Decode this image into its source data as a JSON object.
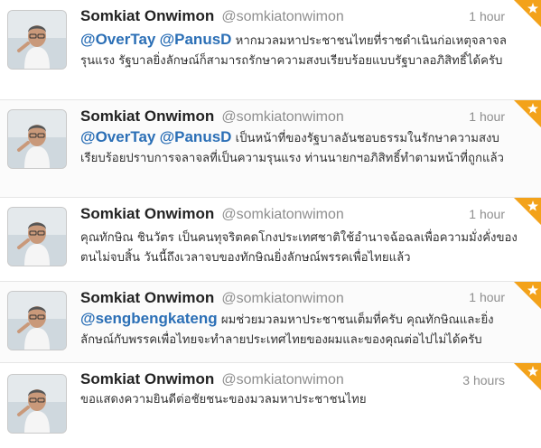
{
  "colors": {
    "star": "#f3a21a",
    "mention": "#2b6fb6"
  },
  "tweets": [
    {
      "name": "Somkiat Onwimon",
      "handle": "@somkiatonwimon",
      "time": "1 hour",
      "mentions": [
        "@OverTay",
        "@PanusD"
      ],
      "text": "หากมวลมหาประชาชนไทยที่ราชดำเนินก่อเหตุจลาจลรุนแรง รัฐบาลยิ่งลักษณ์ก็สามารถรักษาความสงบเรียบร้อยแบบรัฐบาลอภิสิทธิ์ได้ครับ"
    },
    {
      "name": "Somkiat Onwimon",
      "handle": "@somkiatonwimon",
      "time": "1 hour",
      "mentions": [
        "@OverTay",
        "@PanusD"
      ],
      "text": "เป็นหน้าที่ของรัฐบาลอันชอบธรรมในรักษาความสงบเรียบร้อยปราบการจลาจลที่เป็นความรุนแรง ท่านนายกฯอภิสิทธิ์ทำตามหน้าที่ถูกแล้ว"
    },
    {
      "name": "Somkiat Onwimon",
      "handle": "@somkiatonwimon",
      "time": "1 hour",
      "mentions": [],
      "text": "คุณทักษิณ ชินวัตร เป็นคนทุจริตคดโกงประเทศชาติใช้อำนาจฉ้อฉลเพื่อความมั่งคั่งของตนไม่จบสิ้น วันนี้ถึงเวลาจบของทักษิณยิ่งลักษณ์พรรคเพื่อไทยแล้ว"
    },
    {
      "name": "Somkiat Onwimon",
      "handle": "@somkiatonwimon",
      "time": "1 hour",
      "mentions": [
        "@sengbengkateng"
      ],
      "text": "ผมช่วยมวลมหาประชาชนเต็มที่ครับ คุณทักษิณและยิ่งลักษณ์กับพรรคเพื่อไทยจะทำลายประเทศไทยของผมและของคุณต่อไปไม่ได้ครับ"
    },
    {
      "name": "Somkiat Onwimon",
      "handle": "@somkiatonwimon",
      "time": "3 hours",
      "mentions": [],
      "text": "ขอแสดงความยินดีต่อชัยชนะของมวลมหาประชาชนไทย"
    }
  ]
}
